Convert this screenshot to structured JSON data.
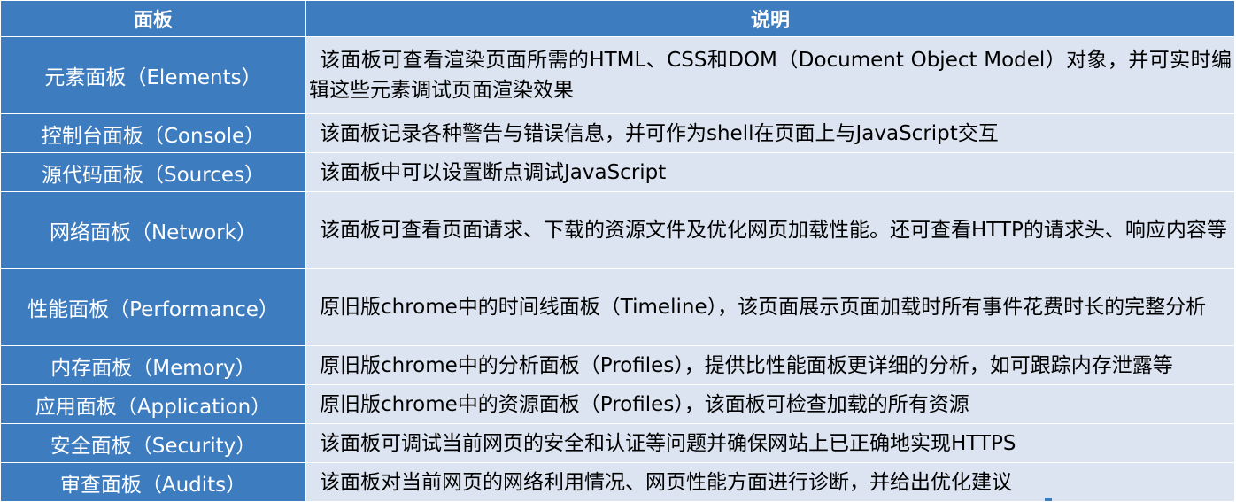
{
  "table": {
    "headers": [
      "面板",
      "说明"
    ],
    "rows": [
      {
        "name": "元素面板（Elements）",
        "desc": "该面板可查看渲染页面所需的HTML、CSS和DOM（Document Object Model）对象，并可实时编辑这些元素调试页面渲染效果"
      },
      {
        "name": "控制台面板（Console）",
        "desc": "该面板记录各种警告与错误信息，并可作为shell在页面上与JavaScript交互"
      },
      {
        "name": "源代码面板（Sources）",
        "desc": "该面板中可以设置断点调试JavaScript"
      },
      {
        "name": "网络面板（Network）",
        "desc": "该面板可查看页面请求、下载的资源文件及优化网页加载性能。还可查看HTTP的请求头、响应内容等"
      },
      {
        "name": "性能面板（Performance）",
        "desc": "原旧版chrome中的时间线面板（Timeline），该页面展示页面加载时所有事件花费时长的完整分析"
      },
      {
        "name": "内存面板（Memory）",
        "desc": "原旧版chrome中的分析面板（Profiles），提供比性能面板更详细的分析，如可跟踪内存泄露等"
      },
      {
        "name": "应用面板（Application）",
        "desc": "原旧版chrome中的资源面板（Profiles），该面板可检查加载的所有资源"
      },
      {
        "name": "安全面板（Security）",
        "desc": "该面板可调试当前网页的安全和认证等问题并确保网站上已正确地实现HTTPS"
      },
      {
        "name": "审查面板（Audits）",
        "desc": "该面板对当前网页的网络利用情况、网页性能方面进行诊断，并给出优化建议"
      }
    ]
  }
}
